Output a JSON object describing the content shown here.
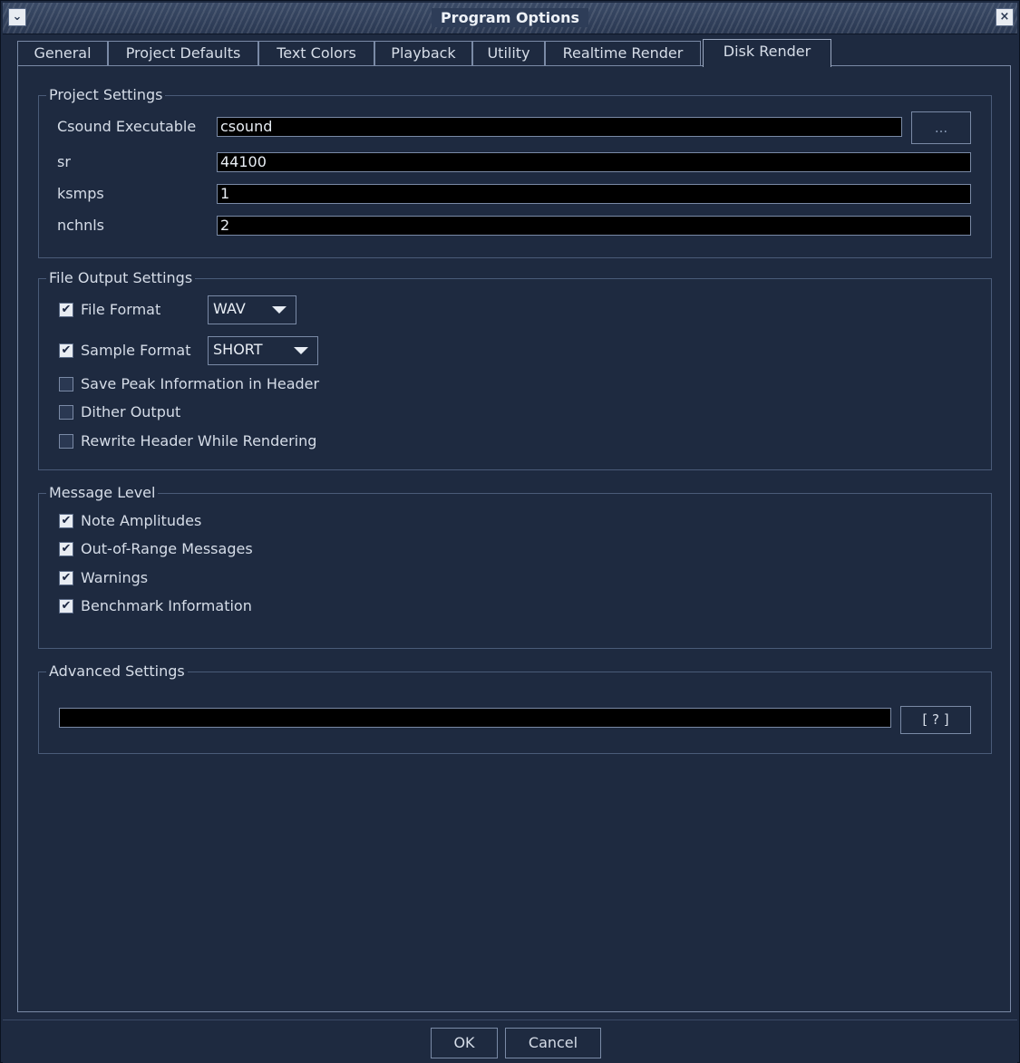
{
  "window": {
    "title": "Program Options"
  },
  "tabs": [
    {
      "label": "General"
    },
    {
      "label": "Project Defaults"
    },
    {
      "label": "Text Colors"
    },
    {
      "label": "Playback"
    },
    {
      "label": "Utility"
    },
    {
      "label": "Realtime Render"
    },
    {
      "label": "Disk Render"
    }
  ],
  "active_tab": "Disk Render",
  "project_settings": {
    "legend": "Project Settings",
    "csound_label": "Csound Executable",
    "csound_value": "csound",
    "browse_label": "...",
    "sr_label": "sr",
    "sr_value": "44100",
    "ksmps_label": "ksmps",
    "ksmps_value": "1",
    "nchnls_label": "nchnls",
    "nchnls_value": "2"
  },
  "file_output": {
    "legend": "File Output Settings",
    "file_format": {
      "label": "File Format",
      "checked": true,
      "value": "WAV"
    },
    "sample_format": {
      "label": "Sample Format",
      "checked": true,
      "value": "SHORT"
    },
    "save_peak": {
      "label": "Save Peak Information in Header",
      "checked": false
    },
    "dither": {
      "label": "Dither Output",
      "checked": false
    },
    "rewrite_header": {
      "label": "Rewrite Header While Rendering",
      "checked": false
    }
  },
  "message_level": {
    "legend": "Message Level",
    "items": [
      {
        "label": "Note Amplitudes",
        "checked": true
      },
      {
        "label": "Out-of-Range Messages",
        "checked": true
      },
      {
        "label": "Warnings",
        "checked": true
      },
      {
        "label": "Benchmark Information",
        "checked": true
      }
    ]
  },
  "advanced": {
    "legend": "Advanced Settings",
    "value": "",
    "help_label": "[ ? ]"
  },
  "footer": {
    "ok_label": "OK",
    "cancel_label": "Cancel"
  },
  "check_glyph": "✔"
}
